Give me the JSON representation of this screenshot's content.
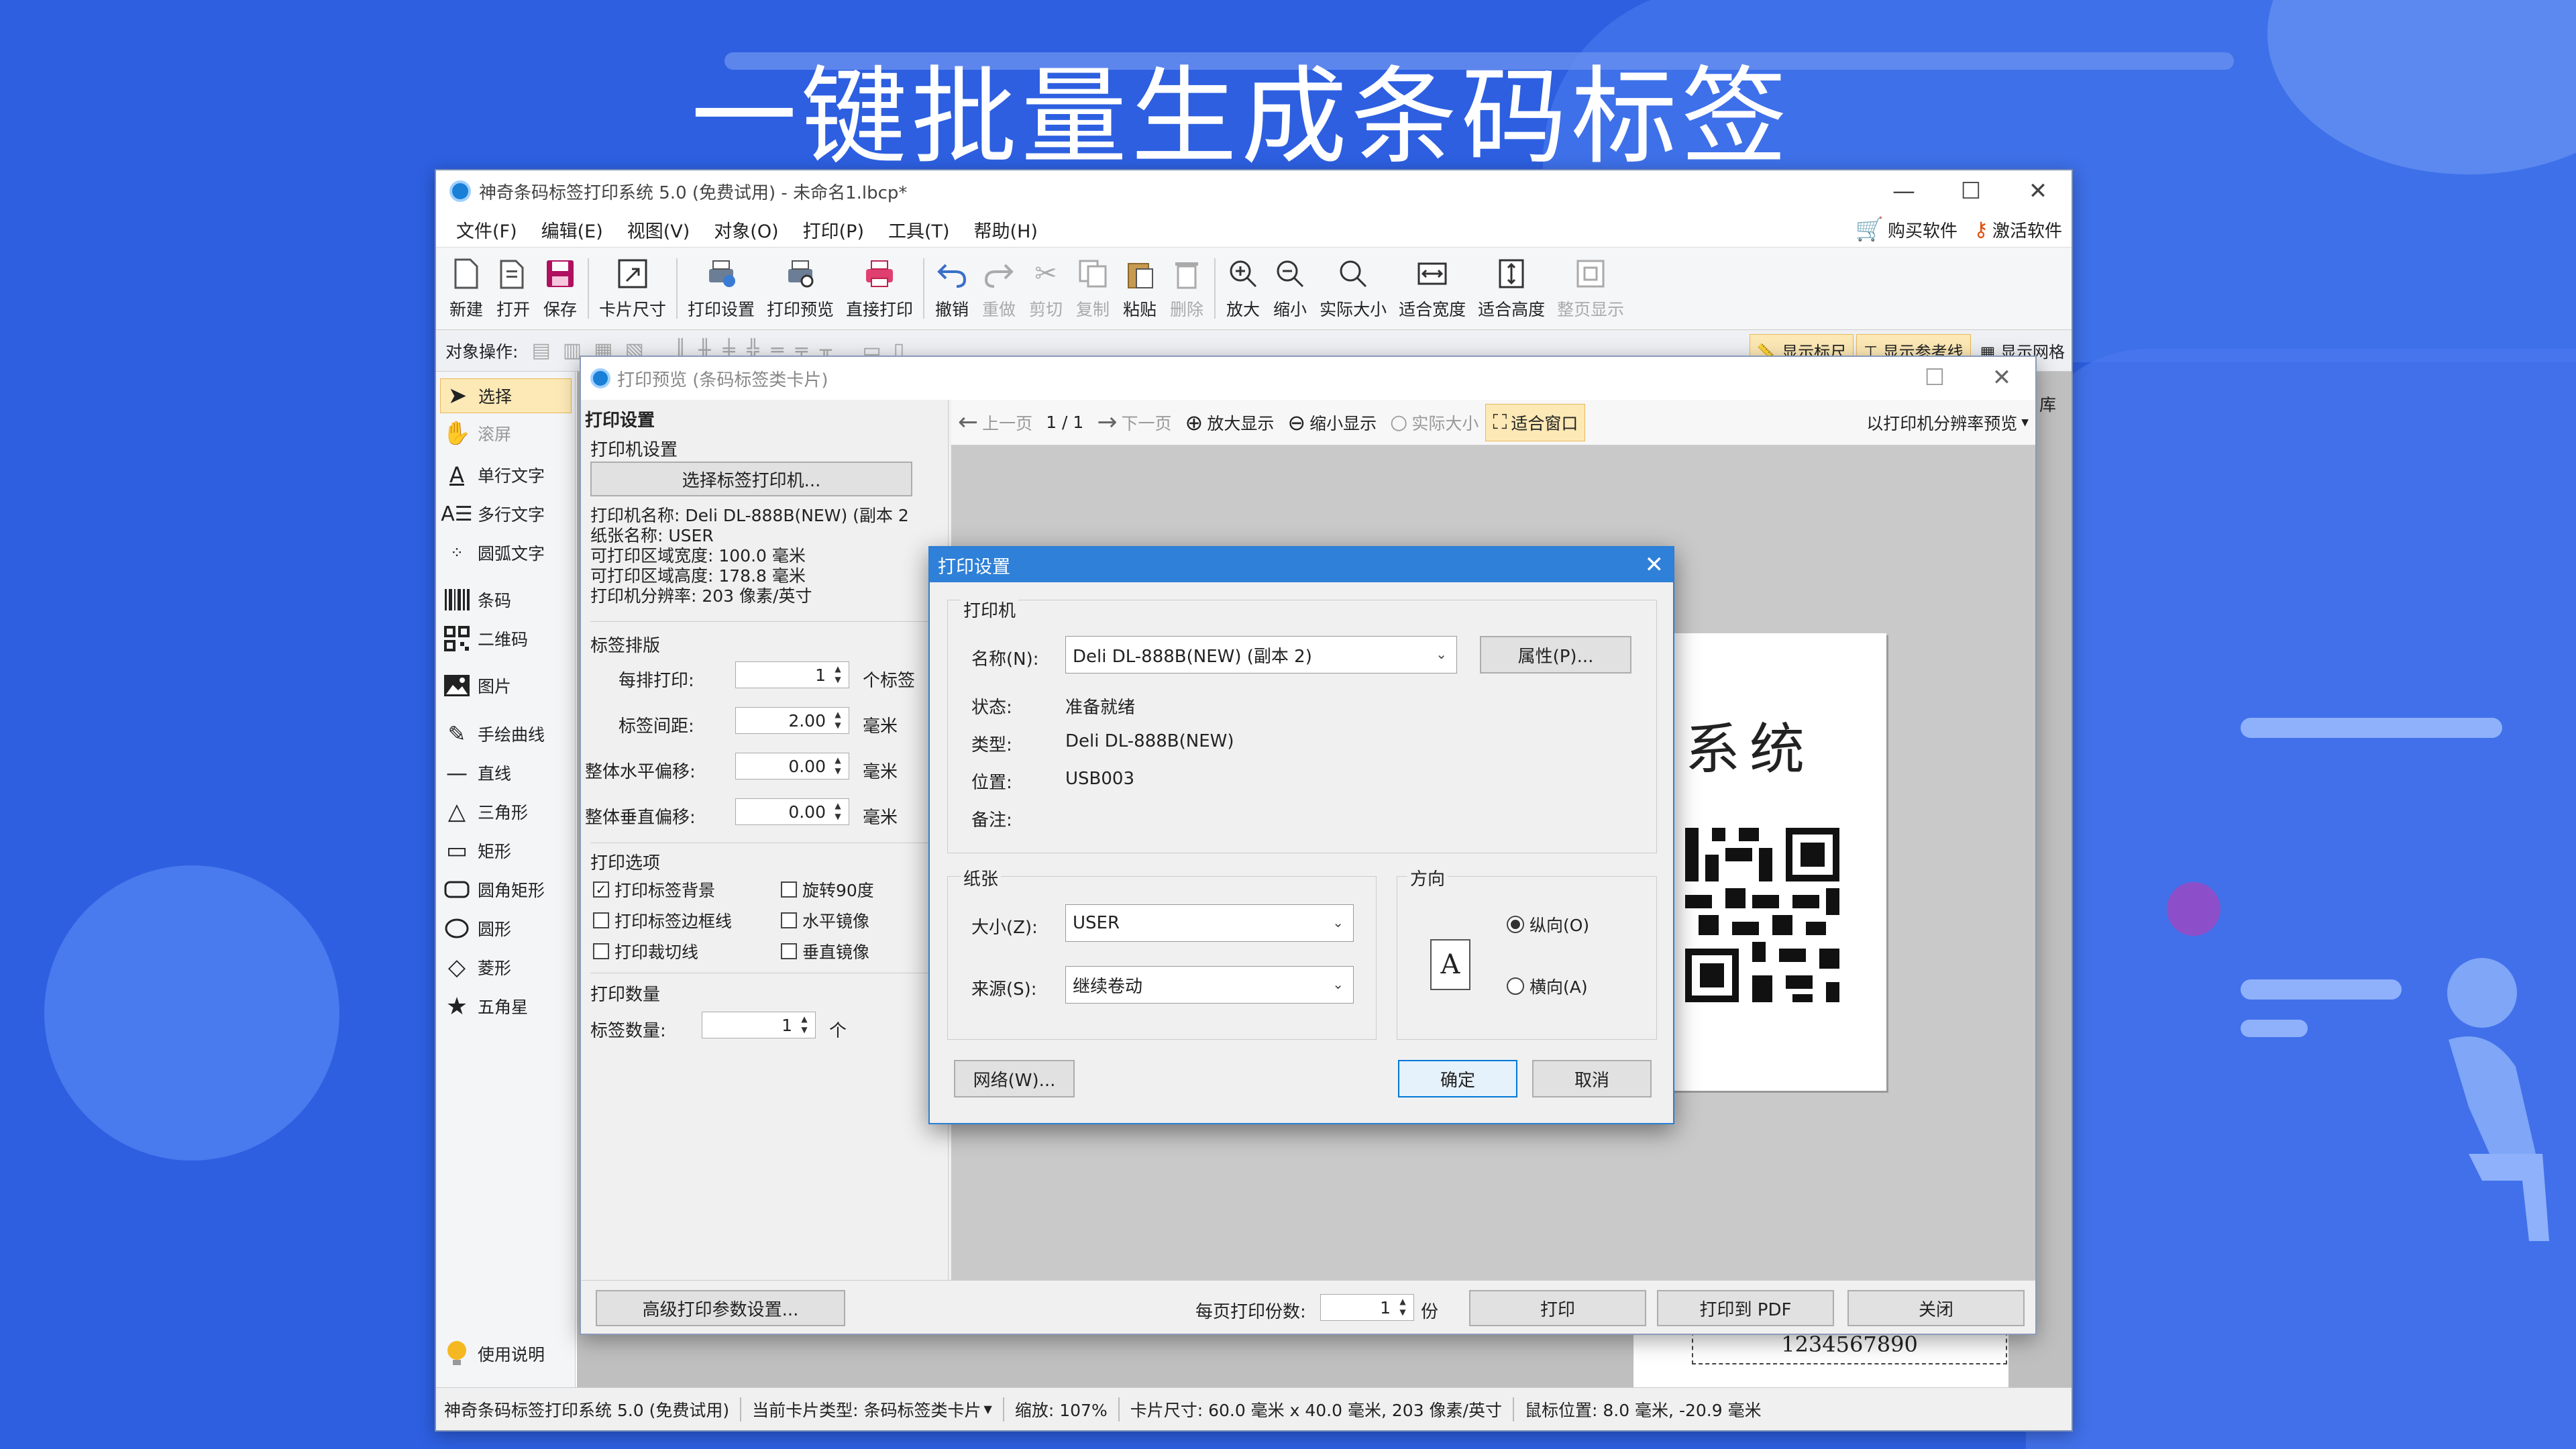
{
  "headline": "一键批量生成条码标签",
  "main_window": {
    "title": "神奇条码标签打印系统 5.0 (免费试用) - 未命名1.lbcp*",
    "menu": [
      "文件(F)",
      "编辑(E)",
      "视图(V)",
      "对象(O)",
      "打印(P)",
      "工具(T)",
      "帮助(H)"
    ],
    "buy_label": "购买软件",
    "activate_label": "激活软件",
    "toolbar": [
      {
        "label": "新建",
        "icon": "new-file-icon"
      },
      {
        "label": "打开",
        "icon": "open-icon"
      },
      {
        "label": "保存",
        "icon": "save-icon"
      },
      {
        "label": "卡片尺寸",
        "icon": "card-size-icon"
      },
      {
        "label": "打印设置",
        "icon": "print-settings-icon"
      },
      {
        "label": "打印预览",
        "icon": "print-preview-icon"
      },
      {
        "label": "直接打印",
        "icon": "printer-icon"
      },
      {
        "label": "撤销",
        "icon": "undo-icon"
      },
      {
        "label": "重做",
        "icon": "redo-icon"
      },
      {
        "label": "剪切",
        "icon": "cut-icon"
      },
      {
        "label": "复制",
        "icon": "copy-icon"
      },
      {
        "label": "粘贴",
        "icon": "paste-icon"
      },
      {
        "label": "删除",
        "icon": "delete-icon"
      },
      {
        "label": "放大",
        "icon": "zoom-in-icon"
      },
      {
        "label": "缩小",
        "icon": "zoom-out-icon"
      },
      {
        "label": "实际大小",
        "icon": "actual-size-icon"
      },
      {
        "label": "适合宽度",
        "icon": "fit-width-icon"
      },
      {
        "label": "适合高度",
        "icon": "fit-height-icon"
      },
      {
        "label": "整页显示",
        "icon": "full-page-icon"
      }
    ],
    "object_ops_label": "对象操作:",
    "show_ruler": "显示标尺",
    "show_guides": "显示参考线",
    "show_grid": "显示网格",
    "library_label": "库",
    "tools": [
      {
        "label": "选择",
        "icon": "pointer-icon"
      },
      {
        "label": "滚屏",
        "icon": "hand-icon"
      },
      {
        "label": "单行文字",
        "icon": "single-line-text-icon"
      },
      {
        "label": "多行文字",
        "icon": "multi-line-text-icon"
      },
      {
        "label": "圆弧文字",
        "icon": "arc-text-icon"
      },
      {
        "label": "条码",
        "icon": "barcode-icon"
      },
      {
        "label": "二维码",
        "icon": "qrcode-icon"
      },
      {
        "label": "图片",
        "icon": "image-icon"
      },
      {
        "label": "手绘曲线",
        "icon": "pencil-icon"
      },
      {
        "label": "直线",
        "icon": "line-icon"
      },
      {
        "label": "三角形",
        "icon": "triangle-icon"
      },
      {
        "label": "矩形",
        "icon": "rectangle-icon"
      },
      {
        "label": "圆角矩形",
        "icon": "rounded-rectangle-icon"
      },
      {
        "label": "圆形",
        "icon": "circle-icon"
      },
      {
        "label": "菱形",
        "icon": "diamond-icon"
      },
      {
        "label": "五角星",
        "icon": "star-icon"
      }
    ],
    "help_label": "使用说明",
    "barcode_text": "1234567890",
    "status": {
      "app": "神奇条码标签打印系统 5.0 (免费试用)",
      "card_type": "当前卡片类型: 条码标签类卡片",
      "zoom": "缩放: 107%",
      "card_size": "卡片尺寸: 60.0 毫米 x 40.0 毫米, 203 像素/英寸",
      "mouse": "鼠标位置: 8.0 毫米, -20.9 毫米"
    }
  },
  "preview_window": {
    "title": "打印预览 (条码标签类卡片)",
    "print_settings_heading": "打印设置",
    "printer_settings_group": "打印机设置",
    "choose_printer_button": "选择标签打印机...",
    "printer_info": [
      "打印机名称: Deli DL-888B(NEW) (副本 2",
      "纸张名称: USER",
      "可打印区域宽度: 100.0 毫米",
      "可打印区域高度: 178.8 毫米",
      "打印机分辨率: 203 像素/英寸"
    ],
    "layout_group": "标签排版",
    "per_row_label": "每排打印:",
    "per_row_value": "1",
    "per_row_unit": "个标签",
    "spacing_label": "标签间距:",
    "spacing_value": "2.00",
    "h_offset_label": "整体水平偏移:",
    "h_offset_value": "0.00",
    "v_offset_label": "整体垂直偏移:",
    "v_offset_value": "0.00",
    "mm_unit": "毫米",
    "options_group": "打印选项",
    "options": [
      {
        "label": "打印标签背景",
        "checked": true
      },
      {
        "label": "旋转90度",
        "checked": false
      },
      {
        "label": "打印标签边框线",
        "checked": false
      },
      {
        "label": "水平镜像",
        "checked": false
      },
      {
        "label": "打印裁切线",
        "checked": false
      },
      {
        "label": "垂直镜像",
        "checked": false
      }
    ],
    "quantity_group": "打印数量",
    "quantity_label": "标签数量:",
    "quantity_value": "1",
    "quantity_unit": "个",
    "prev_page": "上一页",
    "page_indicator": "1 / 1",
    "next_page": "下一页",
    "zoom_in": "放大显示",
    "zoom_out": "缩小显示",
    "actual_size": "实际大小",
    "fit_window": "适合窗口",
    "resolution_preview": "以打印机分辨率预览",
    "preview_title_text": "系统",
    "advanced_button": "高级打印参数设置...",
    "copies_label": "每页打印份数:",
    "copies_value": "1",
    "copies_unit": "份",
    "print_button": "打印",
    "print_pdf_button": "打印到 PDF",
    "close_button": "关闭"
  },
  "print_dialog": {
    "title": "打印设置",
    "printer_group": "打印机",
    "name_label": "名称(N):",
    "name_value": "Deli DL-888B(NEW) (副本 2)",
    "properties_button": "属性(P)...",
    "status_label": "状态:",
    "status_value": "准备就绪",
    "type_label": "类型:",
    "type_value": "Deli DL-888B(NEW)",
    "location_label": "位置:",
    "location_value": "USB003",
    "comment_label": "备注:",
    "paper_group": "纸张",
    "size_label": "大小(Z):",
    "size_value": "USER",
    "source_label": "来源(S):",
    "source_value": "继续卷动",
    "orientation_group": "方向",
    "portrait_label": "纵向(O)",
    "landscape_label": "横向(A)",
    "portrait_selected": true,
    "network_button": "网络(W)...",
    "ok_button": "确定",
    "cancel_button": "取消"
  },
  "colors": {
    "background": "#2d5fe0",
    "dialog_title": "#2f80d8",
    "accent_highlight": "#fde9b6"
  }
}
